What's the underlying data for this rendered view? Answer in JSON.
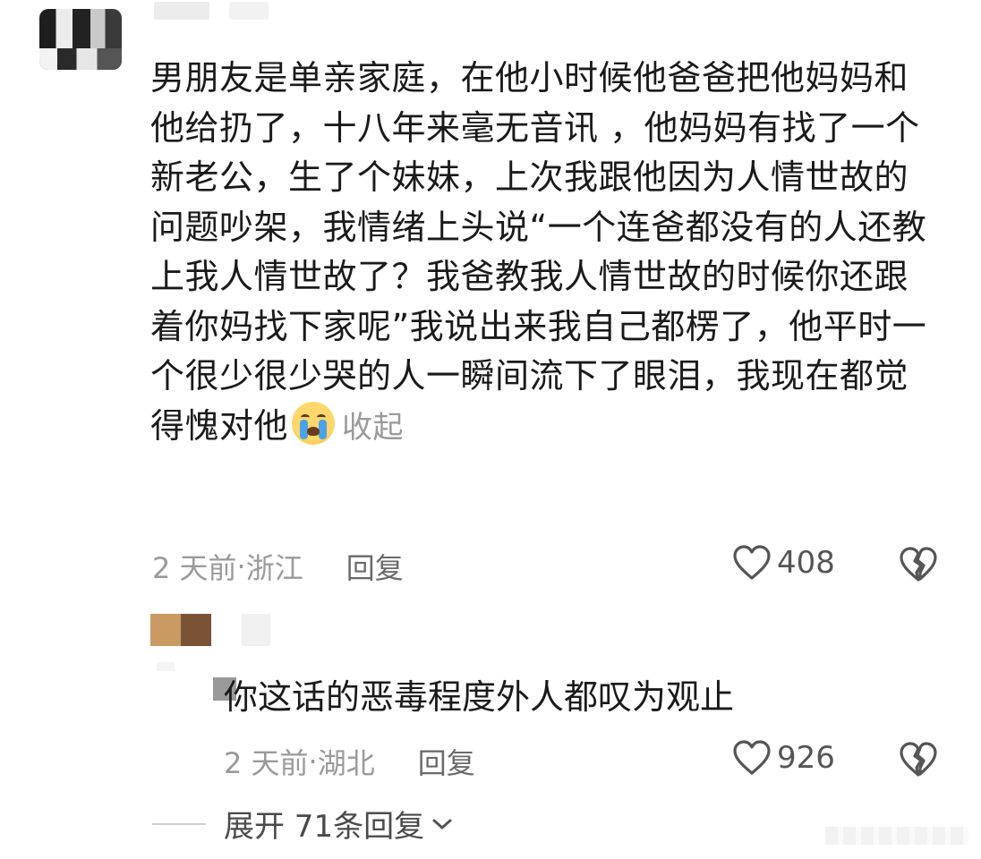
{
  "comment": {
    "paragraph": "男朋友是单亲家庭，在他小时候他爸爸把他妈妈和他给扔了，十八年来毫无音讯 ，他妈妈有找了一个新老公，生了个妹妹，上次我跟他因为人情世故的问题吵架，我情绪上头说“一个连爸都没有的人还教上我人情世故了？我爸教我人情世故的时候你还跟着你妈找下家呢”我说出来我自己都楞了，他平时一个很少很少哭的人一瞬间流下了眼泪，我现在都觉得愧对他",
    "emoji": "crying-face",
    "collapse_label": "收起",
    "time": "2 天前",
    "location": "浙江",
    "separator": " · ",
    "reply_label": "回复",
    "like_count": "408"
  },
  "reply": {
    "text": "你这话的恶毒程度外人都叹为观止",
    "time": "2 天前",
    "location": "湖北",
    "separator": " · ",
    "reply_label": "回复",
    "like_count": "926"
  },
  "expand": {
    "label": "展开 71条回复"
  },
  "colors": {
    "text": "#1a1a1a",
    "meta": "#9a9a9a",
    "reply_link": "#6a6a6a",
    "icon": "#555555"
  }
}
